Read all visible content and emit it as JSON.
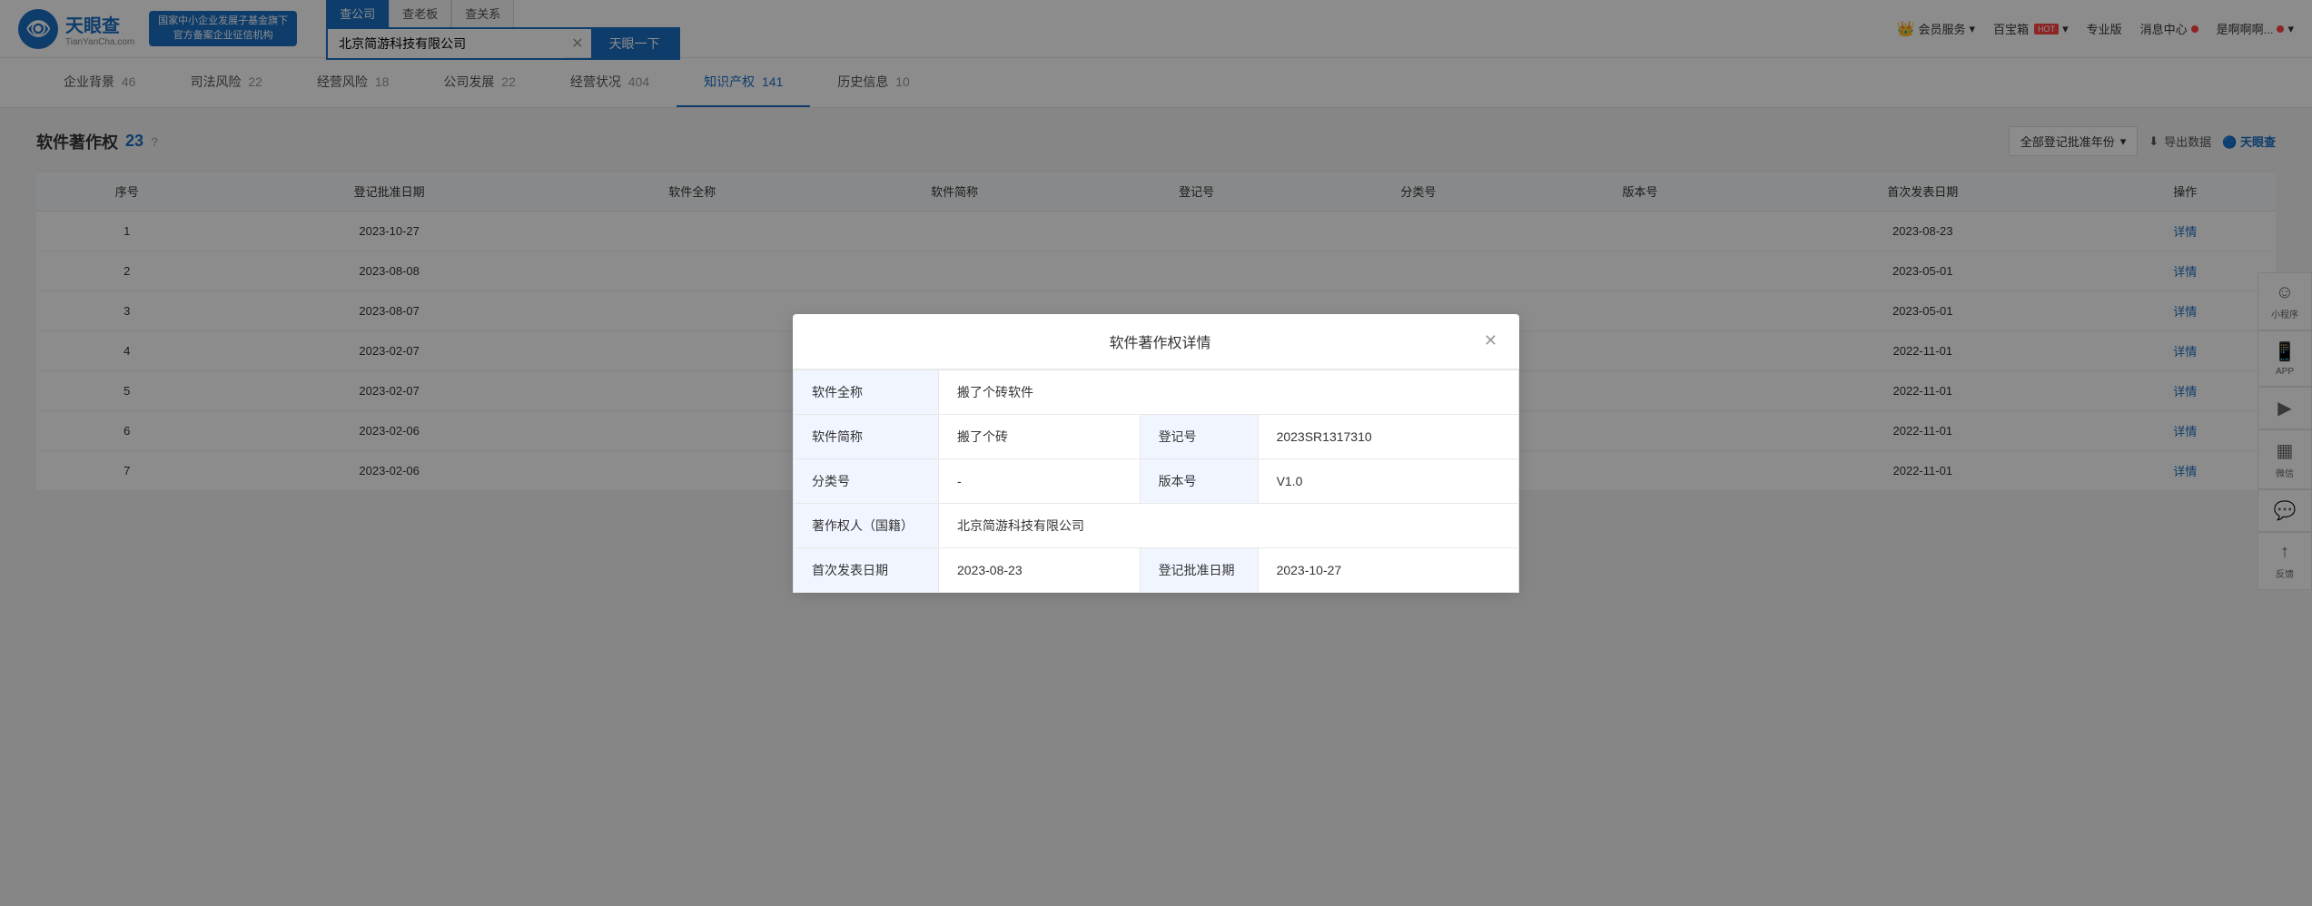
{
  "header": {
    "logo_main": "天眼查",
    "logo_sub": "TianYanCha.com",
    "gov_banner_line1": "国家中小企业发展子基金旗下",
    "gov_banner_line2": "官方备案企业征信机构",
    "search_tabs": [
      {
        "label": "查公司",
        "active": true
      },
      {
        "label": "查老板",
        "active": false
      },
      {
        "label": "查关系",
        "active": false
      }
    ],
    "search_value": "北京简游科技有限公司",
    "search_btn_label": "天眼一下",
    "nav_items": [
      {
        "label": "会员服务",
        "icon": "crown",
        "has_dropdown": true
      },
      {
        "label": "百宝箱",
        "has_hot": true,
        "has_dropdown": true
      },
      {
        "label": "专业版"
      },
      {
        "label": "消息中心",
        "has_dot": true
      },
      {
        "label": "是啊啊啊...",
        "has_dropdown": true,
        "has_dot": true
      }
    ]
  },
  "nav_tabs": [
    {
      "label": "企业背景",
      "count": "46"
    },
    {
      "label": "司法风险",
      "count": "22"
    },
    {
      "label": "经营风险",
      "count": "18"
    },
    {
      "label": "公司发展",
      "count": "22"
    },
    {
      "label": "经营状况",
      "count": "404"
    },
    {
      "label": "知识产权",
      "count": "141",
      "active": true
    },
    {
      "label": "历史信息",
      "count": "10"
    }
  ],
  "section": {
    "title": "软件著作权",
    "count": "23",
    "year_filter_label": "全部登记批准年份",
    "export_label": "导出数据"
  },
  "table": {
    "columns": [
      "序号",
      "登记批准日期",
      "软件全称",
      "软件简称",
      "登记号",
      "分类号",
      "版本号",
      "首次发表日期",
      "操作"
    ],
    "rows": [
      {
        "seq": "1",
        "approve_date": "2023-10-27",
        "full_name": "",
        "short_name": "",
        "reg_no": "",
        "category": "",
        "version": "",
        "publish_date": "2023-08-23",
        "action": "详情"
      },
      {
        "seq": "2",
        "approve_date": "2023-08-08",
        "full_name": "",
        "short_name": "",
        "reg_no": "",
        "category": "",
        "version": "",
        "publish_date": "2023-05-01",
        "action": "详情"
      },
      {
        "seq": "3",
        "approve_date": "2023-08-07",
        "full_name": "",
        "short_name": "",
        "reg_no": "",
        "category": "",
        "version": "",
        "publish_date": "2023-05-01",
        "action": "详情"
      },
      {
        "seq": "4",
        "approve_date": "2023-02-07",
        "full_name": "",
        "short_name": "",
        "reg_no": "",
        "category": "",
        "version": "",
        "publish_date": "2022-11-01",
        "action": "详情"
      },
      {
        "seq": "5",
        "approve_date": "2023-02-07",
        "full_name": "",
        "short_name": "",
        "reg_no": "",
        "category": "",
        "version": "",
        "publish_date": "2022-11-01",
        "action": "详情"
      },
      {
        "seq": "6",
        "approve_date": "2023-02-06",
        "full_name": "",
        "short_name": "",
        "reg_no": "",
        "category": "",
        "version": "",
        "publish_date": "2022-11-01",
        "action": "详情"
      },
      {
        "seq": "7",
        "approve_date": "2023-02-06",
        "full_name": "",
        "short_name": "",
        "reg_no": "",
        "category": "",
        "version": "",
        "publish_date": "2022-11-01",
        "action": "详情"
      }
    ]
  },
  "float_icons": [
    {
      "icon": "☺",
      "label": "小程序"
    },
    {
      "icon": "📱",
      "label": "APP"
    },
    {
      "icon": "▶",
      "label": ""
    },
    {
      "icon": "▦",
      "label": "微信"
    },
    {
      "icon": "💬",
      "label": ""
    },
    {
      "icon": "↑",
      "label": "反馈"
    }
  ],
  "modal": {
    "title": "软件著作权详情",
    "fields": [
      {
        "label": "软件全称",
        "value": "搬了个砖软件",
        "colspan": true
      },
      {
        "label": "软件简称",
        "value": "搬了个砖",
        "label2": "登记号",
        "value2": "2023SR1317310"
      },
      {
        "label": "分类号",
        "value": "-",
        "label2": "版本号",
        "value2": "V1.0"
      },
      {
        "label": "著作权人（国籍）",
        "value": "北京简游科技有限公司",
        "colspan": true
      },
      {
        "label": "首次发表日期",
        "value": "2023-08-23",
        "label2": "登记批准日期",
        "value2": "2023-10-27"
      }
    ]
  }
}
